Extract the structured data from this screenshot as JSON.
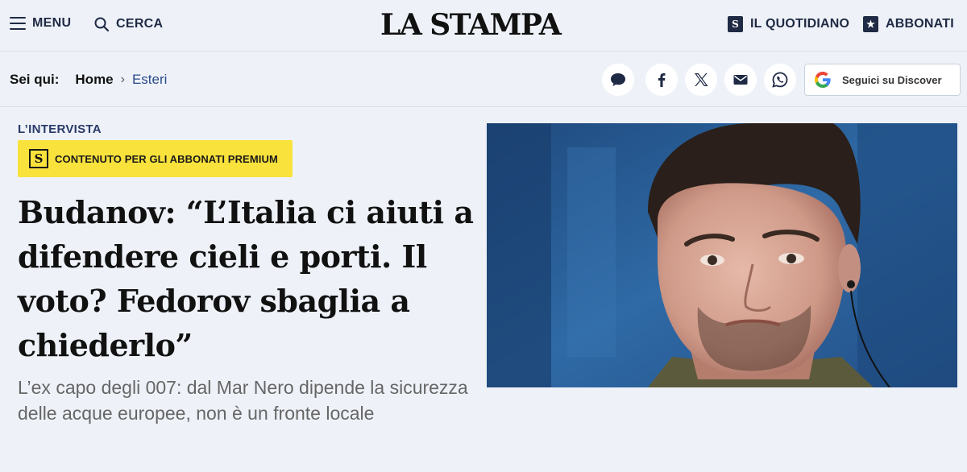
{
  "header": {
    "menu_label": "MENU",
    "search_label": "CERCA",
    "logo_text": "LA STAMPA",
    "quotidiano_label": "IL QUOTIDIANO",
    "quotidiano_icon": "S",
    "abbonati_label": "ABBONATI",
    "abbonati_icon": "★"
  },
  "breadcrumb": {
    "prefix": "Sei qui:",
    "home": "Home",
    "separator": "›",
    "current": "Esteri"
  },
  "share": {
    "icons": [
      "comment-icon",
      "facebook-icon",
      "x-icon",
      "email-icon",
      "whatsapp-icon"
    ],
    "discover_label": "Seguici su Discover"
  },
  "article": {
    "kicker": "L’INTERVISTA",
    "premium_badge": "CONTENUTO PER GLI ABBONATI PREMIUM",
    "premium_icon": "S",
    "headline": "Budanov: “L’Italia ci aiuti a difendere cieli e porti. Il voto? Fedorov sbaglia a chiederlo”",
    "summary": "L’ex capo degli 007: dal Mar Nero dipende la sicurezza delle acque europee, non è un fronte locale"
  },
  "colors": {
    "background": "#eef2f8",
    "navy": "#1f2a44",
    "premium_yellow": "#f9e23c",
    "link_blue": "#2a4a8a"
  }
}
